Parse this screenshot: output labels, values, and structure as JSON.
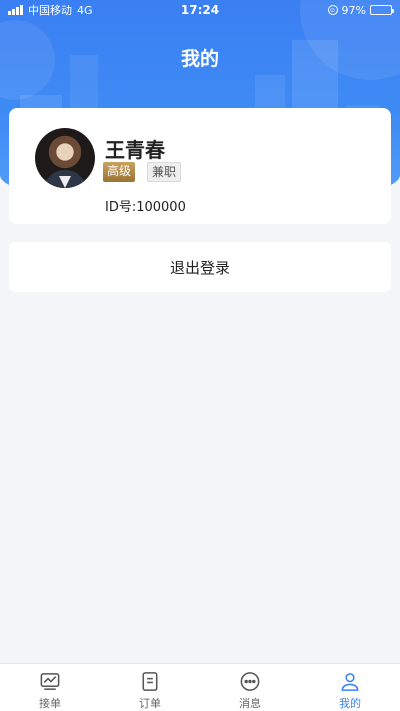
{
  "status_bar": {
    "carrier": "中国移动",
    "network": "4G",
    "time": "17:24",
    "battery": "97%",
    "battery_level": 0.97
  },
  "header": {
    "title": "我的"
  },
  "profile": {
    "name": "王青春",
    "level_tag": "高级",
    "type_tag": "兼职",
    "id_text": "ID号:100000"
  },
  "actions": {
    "logout_label": "退出登录"
  },
  "tabs": [
    {
      "label": "接单",
      "icon": "chart-icon",
      "active": false
    },
    {
      "label": "订单",
      "icon": "document-icon",
      "active": false
    },
    {
      "label": "消息",
      "icon": "chat-icon",
      "active": false
    },
    {
      "label": "我的",
      "icon": "user-icon",
      "active": true
    }
  ],
  "colors": {
    "accent": "#3b82f6",
    "header": "#3f8cf5",
    "tag_gold": "#b08a48"
  }
}
